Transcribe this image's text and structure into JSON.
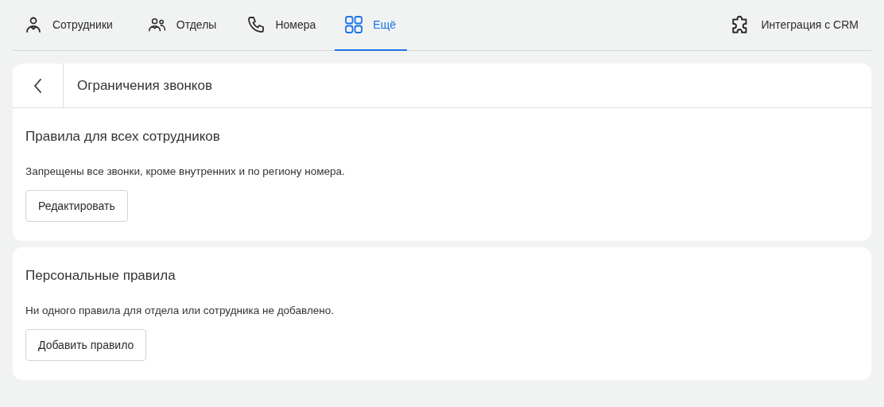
{
  "tabs": [
    {
      "label": "Сотрудники",
      "selected": false
    },
    {
      "label": "Отделы",
      "selected": false
    },
    {
      "label": "Номера",
      "selected": false
    },
    {
      "label": "Ещё",
      "selected": true
    }
  ],
  "integration_link": {
    "label": "Интеграция с CRM"
  },
  "page_header": {
    "title": "Ограничения звонков"
  },
  "sections": [
    {
      "title": "Правила для всех сотрудников",
      "description": "Запрещены все звонки, кроме внутренних и по региону номера.",
      "button": "Редактировать"
    },
    {
      "title": "Персональные правила",
      "description": "Ни одного правила для отдела или сотрудника не добавлено.",
      "button": "Добавить правило"
    }
  ]
}
